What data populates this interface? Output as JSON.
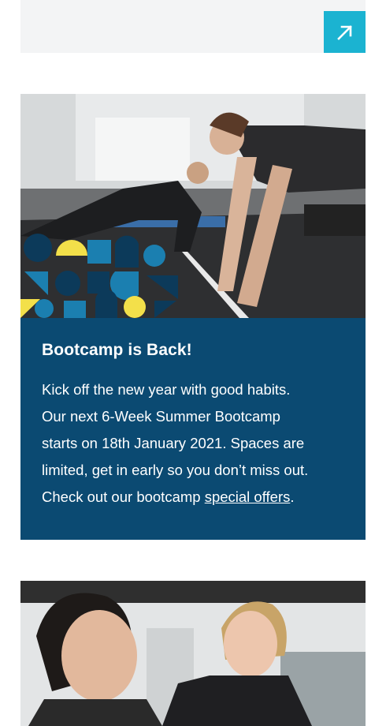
{
  "colors": {
    "accent": "#1bb3d1",
    "card_bg": "#0b4a72",
    "pattern_dark": "#0c3a5a",
    "pattern_teal": "#1b7fb0",
    "pattern_yellow": "#f3e04a"
  },
  "top_card": {
    "link_icon": "arrow-up-right-icon"
  },
  "bootcamp": {
    "title": "Bootcamp is Back!",
    "body_lines": [
      "Kick off the new year with good habits.",
      "Our next 6-Week Summer Bootcamp",
      "starts on 18th January 2021. Spaces are",
      "limited, get in early so you don’t miss out."
    ],
    "body_last_prefix": "Check out our bootcamp ",
    "link_text": "special offers",
    "body_last_suffix": "."
  }
}
